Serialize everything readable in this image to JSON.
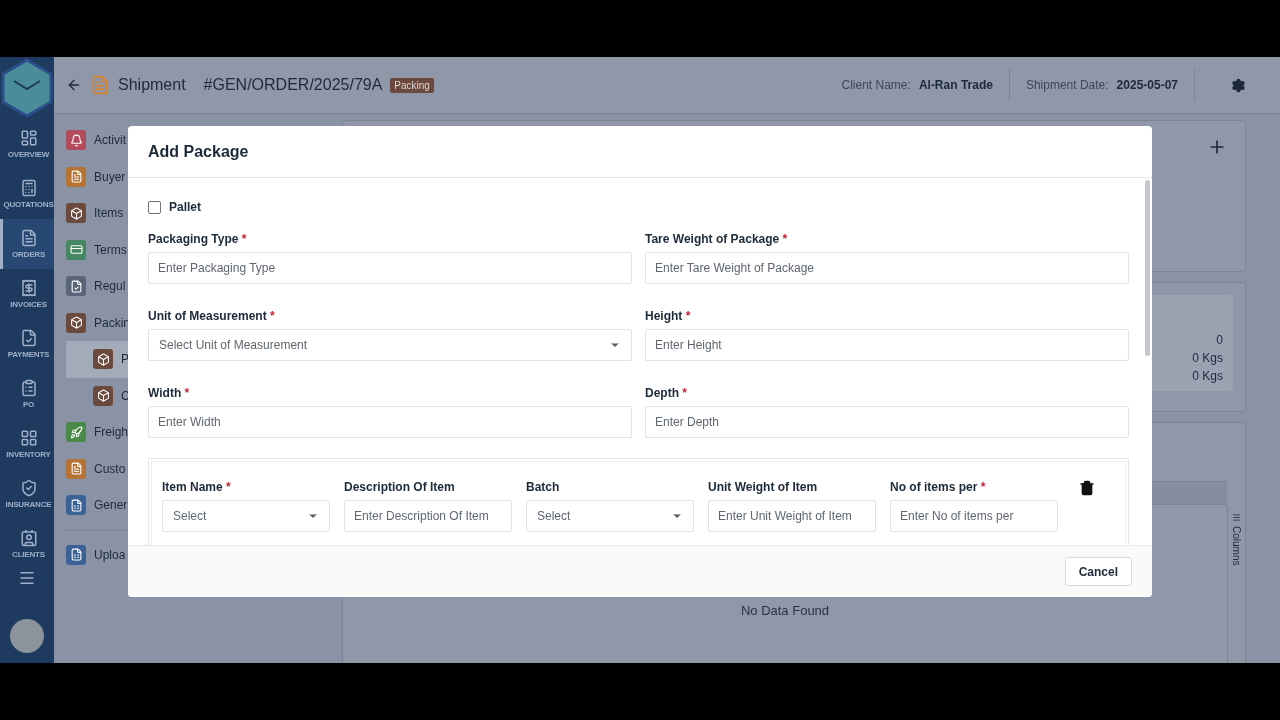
{
  "nav": {
    "items": [
      {
        "label": "OVERVIEW",
        "selected": false
      },
      {
        "label": "QUOTATIONS",
        "selected": false
      },
      {
        "label": "ORDERS",
        "selected": true
      },
      {
        "label": "INVOICES",
        "selected": false
      },
      {
        "label": "PAYMENTS",
        "selected": false
      },
      {
        "label": "PO",
        "selected": false
      },
      {
        "label": "INVENTORY",
        "selected": false
      },
      {
        "label": "INSURANCE",
        "selected": false
      },
      {
        "label": "CLIENTS",
        "selected": false
      }
    ]
  },
  "header": {
    "title": "Shipment",
    "order_number": "#GEN/ORDER/2025/79A",
    "status": "Packing",
    "client_label": "Client Name:",
    "client_name": "Al-Ran Trade",
    "date_label": "Shipment Date:",
    "date": "2025-05-07"
  },
  "sections": [
    {
      "label": "Activit",
      "color": "#b04a5c"
    },
    {
      "label": "Buyer",
      "color": "#b57433"
    },
    {
      "label": "Items",
      "color": "#6b4a3d"
    },
    {
      "label": "Terms",
      "color": "#468763"
    },
    {
      "label": "Regul",
      "color": "#5a6478"
    },
    {
      "label": "Packin",
      "color": "#6b4a3d",
      "children": [
        {
          "label": "P",
          "color": "#6b4a3d",
          "selected": true
        },
        {
          "label": "C",
          "color": "#6b4a3d",
          "selected": false
        }
      ]
    },
    {
      "label": "Freigh",
      "color": "#4a8a48"
    },
    {
      "label": "Custo",
      "color": "#b57433"
    },
    {
      "label": "Gener",
      "color": "#3a6296"
    },
    {
      "label": "Uploa",
      "color": "#3a6296"
    }
  ],
  "summary": {
    "values": [
      "0",
      "0 Kgs",
      "0 Kgs"
    ]
  },
  "table": {
    "side_tab": "Columns",
    "empty_text": "No Data Found"
  },
  "modal": {
    "title": "Add Package",
    "pallet": {
      "label": "Pallet",
      "checked": false
    },
    "fields": [
      {
        "label": "Packaging Type",
        "mark": "*",
        "placeholder": "Enter Packaging Type",
        "kind": "text"
      },
      {
        "label": "Tare Weight of Package",
        "mark": "*",
        "placeholder": "Enter Tare Weight of Package",
        "kind": "text"
      },
      {
        "label": "Unit of Measurement",
        "mark": "*",
        "placeholder": "Select Unit of Measurement",
        "kind": "select"
      },
      {
        "label": "Height",
        "mark": "*",
        "placeholder": "Enter Height",
        "kind": "text"
      },
      {
        "label": "Width",
        "mark": "*",
        "placeholder": "Enter Width",
        "kind": "text"
      },
      {
        "label": "Depth",
        "mark": "*",
        "placeholder": "Enter Depth",
        "kind": "text"
      }
    ],
    "item_fields": [
      {
        "label": "Item Name",
        "mark": "*",
        "placeholder": "Select",
        "kind": "select"
      },
      {
        "label": "Description Of Item",
        "placeholder": "Enter Description Of Item",
        "kind": "text"
      },
      {
        "label": "Batch",
        "placeholder": "Select",
        "kind": "select"
      },
      {
        "label": "Unit Weight of Item",
        "placeholder": "Enter Unit Weight of Item",
        "kind": "text"
      },
      {
        "label": "No of items per",
        "mark": "*",
        "placeholder": "Enter No of items per",
        "kind": "text"
      }
    ],
    "cancel": "Cancel"
  }
}
